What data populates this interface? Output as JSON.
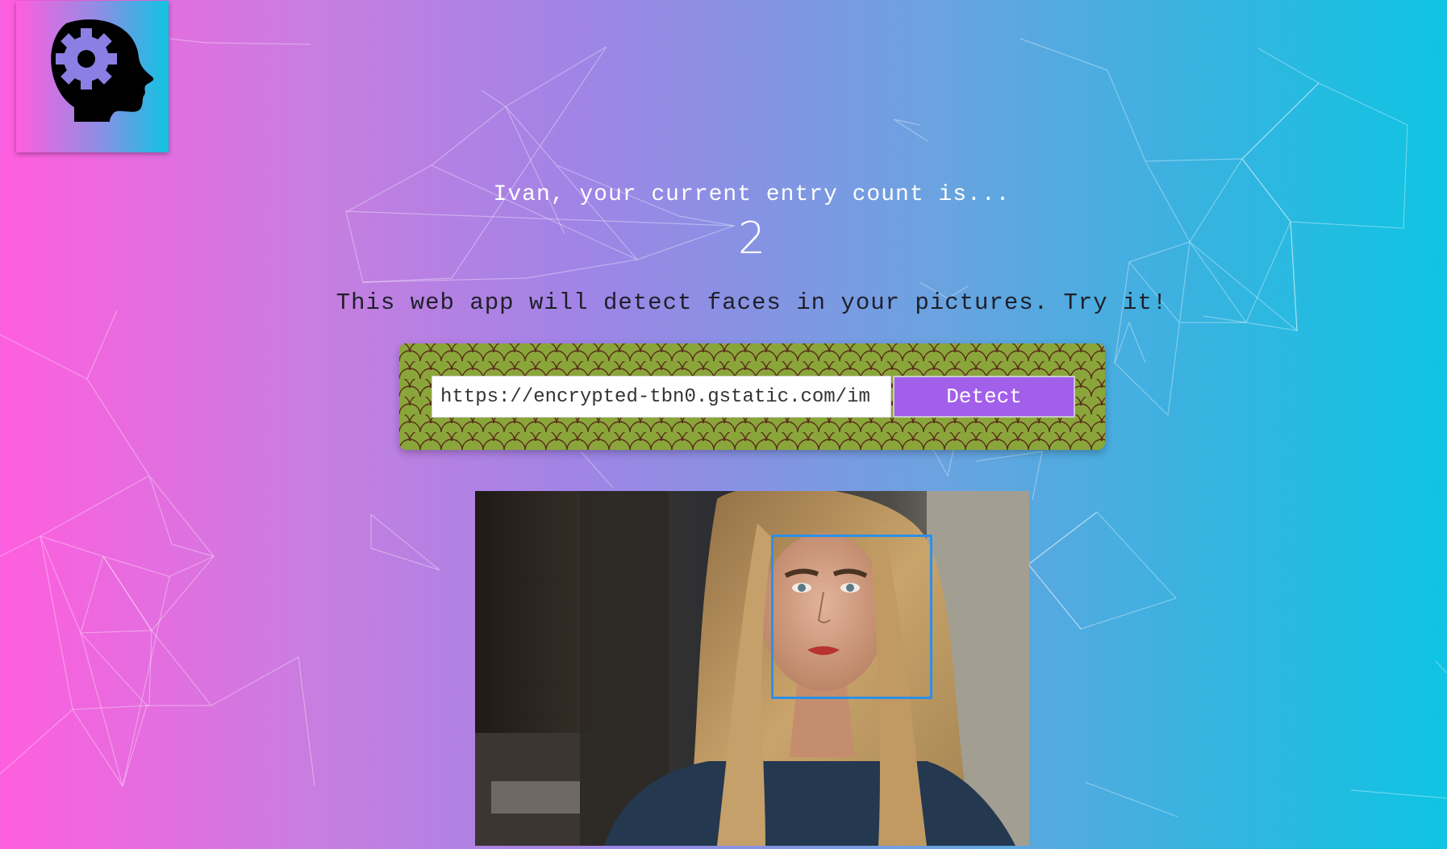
{
  "header": {
    "logo_icon": "head-gear-icon"
  },
  "entry": {
    "greeting": "Ivan, your current entry count is...",
    "count": "2"
  },
  "intro": {
    "tagline": "This web app will detect faces in your pictures. Try it!"
  },
  "form": {
    "url_value": "https://encrypted-tbn0.gstatic.com/im",
    "detect_label": "Detect"
  },
  "result": {
    "image_icon": "detected-face-photo",
    "face_box_color": "#2e8fe6"
  },
  "colors": {
    "gradient_left": "#ff5edf",
    "gradient_right": "#0fc4e2",
    "button": "#a25fea",
    "panel": "#8aa63a"
  }
}
